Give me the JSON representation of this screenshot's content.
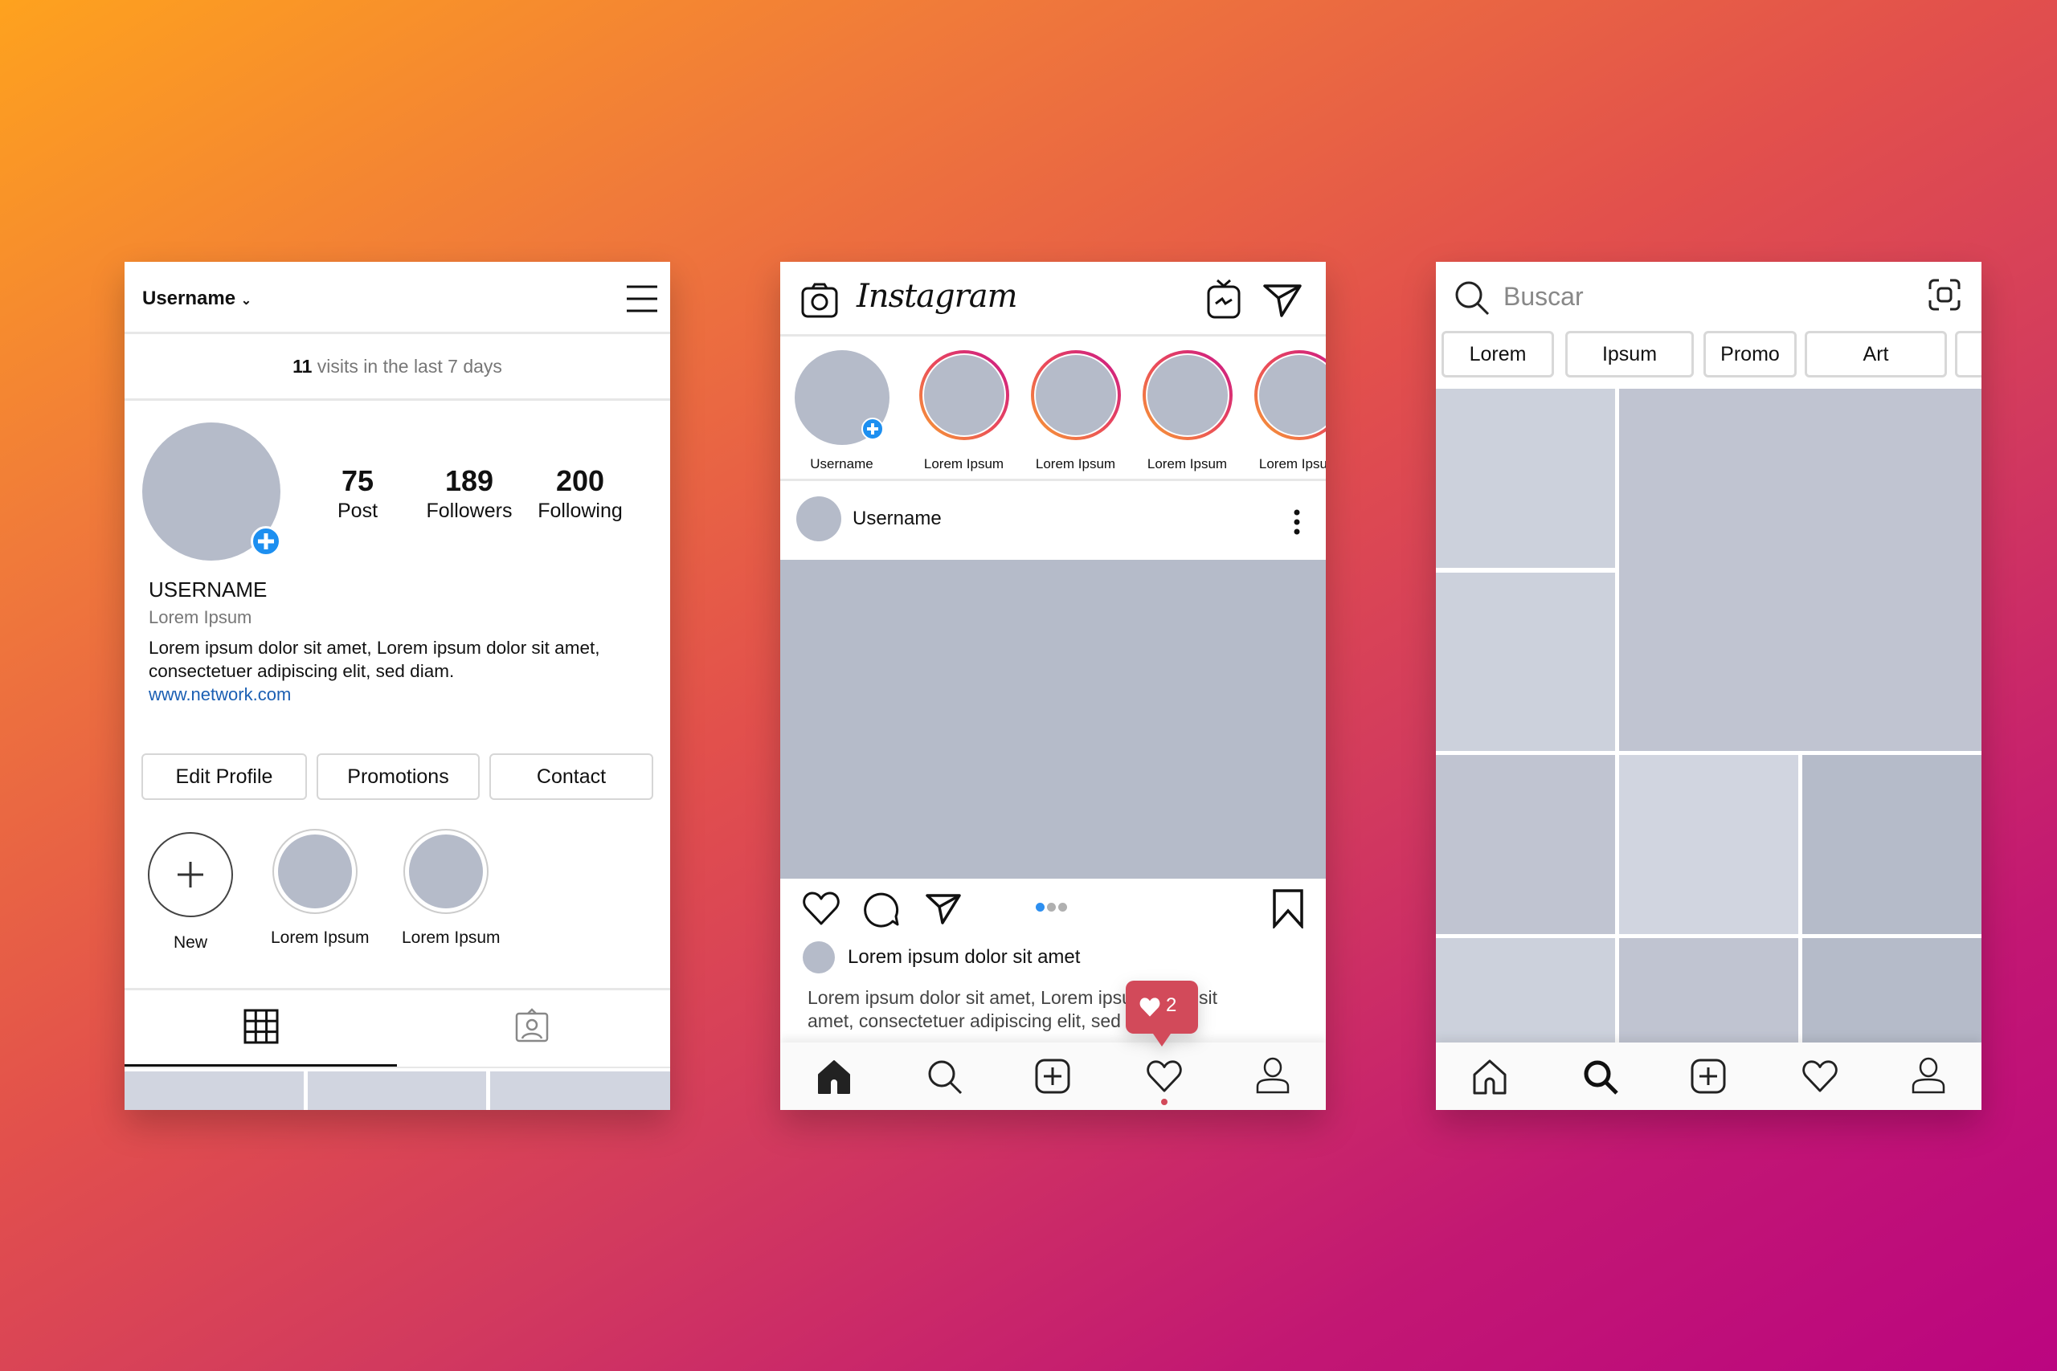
{
  "profile_screen": {
    "username_header": "Username",
    "visits_count": "11",
    "visits_text": " visits in the last 7 days",
    "stats": [
      {
        "value": "75",
        "label": "Post"
      },
      {
        "value": "189",
        "label": "Followers"
      },
      {
        "value": "200",
        "label": "Following"
      }
    ],
    "display_name": "USERNAME",
    "category": "Lorem Ipsum",
    "bio_line1": "Lorem ipsum dolor sit amet, Lorem ipsum dolor sit amet,",
    "bio_line2": "consectetuer adipiscing elit, sed diam.",
    "website": "www.network.com",
    "buttons": [
      "Edit Profile",
      "Promotions",
      "Contact"
    ],
    "highlights": [
      {
        "label": "New",
        "icon": "plus-icon"
      },
      {
        "label": "Lorem Ipsum"
      },
      {
        "label": "Lorem Ipsum"
      }
    ],
    "tabs": [
      {
        "icon": "grid-icon",
        "active": true
      },
      {
        "icon": "tagged-icon",
        "active": false
      }
    ]
  },
  "feed_screen": {
    "logo": "Instagram",
    "header_icons": [
      "camera-icon",
      "igtv-icon",
      "direct-message-icon"
    ],
    "stories": [
      {
        "label": "Username",
        "own": true
      },
      {
        "label": "Lorem Ipsum"
      },
      {
        "label": "Lorem Ipsum"
      },
      {
        "label": "Lorem Ipsum"
      },
      {
        "label": "Lorem Ipsum"
      }
    ],
    "post": {
      "username": "Username",
      "carousel_index": 1,
      "carousel_total": 3,
      "caption_title": "Lorem ipsum dolor sit amet",
      "caption_line1": "Lorem ipsum dolor sit amet, Lorem ipsum dolor sit",
      "caption_line2": "amet, consectetuer adipiscing elit, sed diam."
    },
    "notification": {
      "icon": "heart-icon",
      "count": "2"
    },
    "nav_active": "home"
  },
  "search_screen": {
    "search_placeholder": "Buscar",
    "chips": [
      "Lorem",
      "Ipsum",
      "Promo",
      "Art",
      ""
    ],
    "nav_active": "search"
  },
  "colors": {
    "accent_blue": "#1d8ff0",
    "notification_red": "#d24a5a",
    "link_blue": "#1b5fb3",
    "placeholder_gray": "#b5bbc9",
    "gradient_start": "#fea21e",
    "gradient_end": "#bb0580"
  }
}
